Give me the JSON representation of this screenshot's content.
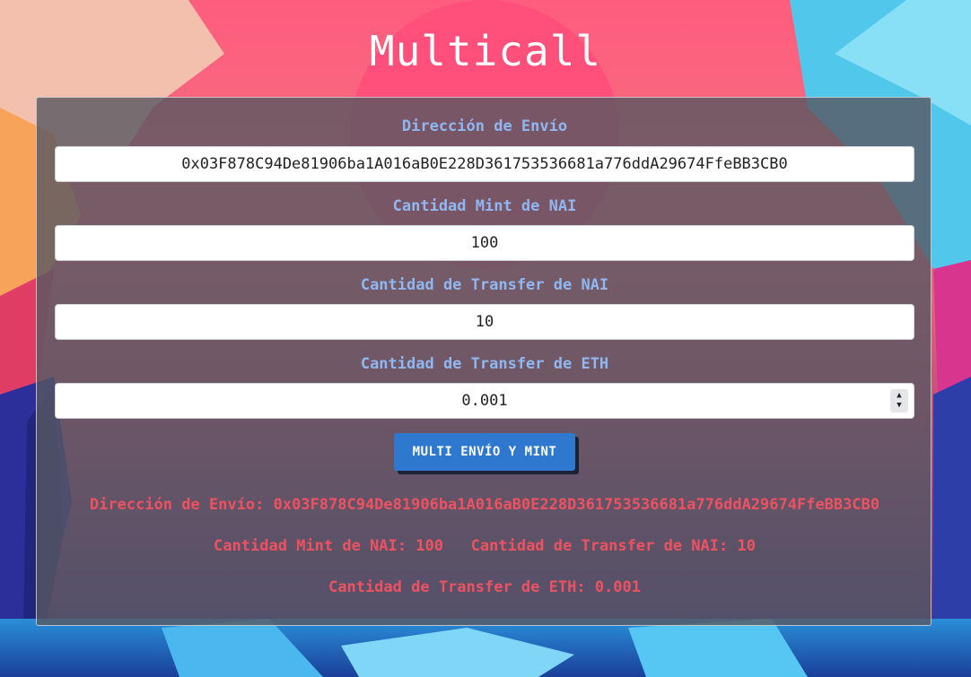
{
  "app": {
    "title": "Multicall"
  },
  "form": {
    "address_label": "Dirección de Envío",
    "address_value": "0x03F878C94De81906ba1A016aB0E228D361753536681a776ddA29674FfeBB3CB0",
    "mint_label": "Cantidad Mint de NAI",
    "mint_value": "100",
    "transfer_nai_label": "Cantidad de Transfer de NAI",
    "transfer_nai_value": "10",
    "transfer_eth_label": "Cantidad de Transfer de ETH",
    "transfer_eth_value": "0.001",
    "submit_label": "MULTI ENVÍO Y MINT"
  },
  "summary": {
    "address_prefix": "Dirección de Envío: ",
    "address_value": "0x03F878C94De81906ba1A016aB0E228D361753536681a776ddA29674FfeBB3CB0",
    "mint_prefix": "Cantidad Mint de NAI: ",
    "mint_value": "100",
    "transfer_nai_prefix": "Cantidad de Transfer de NAI: ",
    "transfer_nai_value": "10",
    "transfer_eth_prefix": "Cantidad de Transfer de ETH: ",
    "transfer_eth_value": "0.001"
  },
  "icons": {
    "spinner_up": "caret-up-icon",
    "spinner_down": "caret-down-icon"
  },
  "colors": {
    "label": "#8fb7f2",
    "summary_text": "#ee5260",
    "button": "#2e78cf",
    "panel": "#585862"
  }
}
